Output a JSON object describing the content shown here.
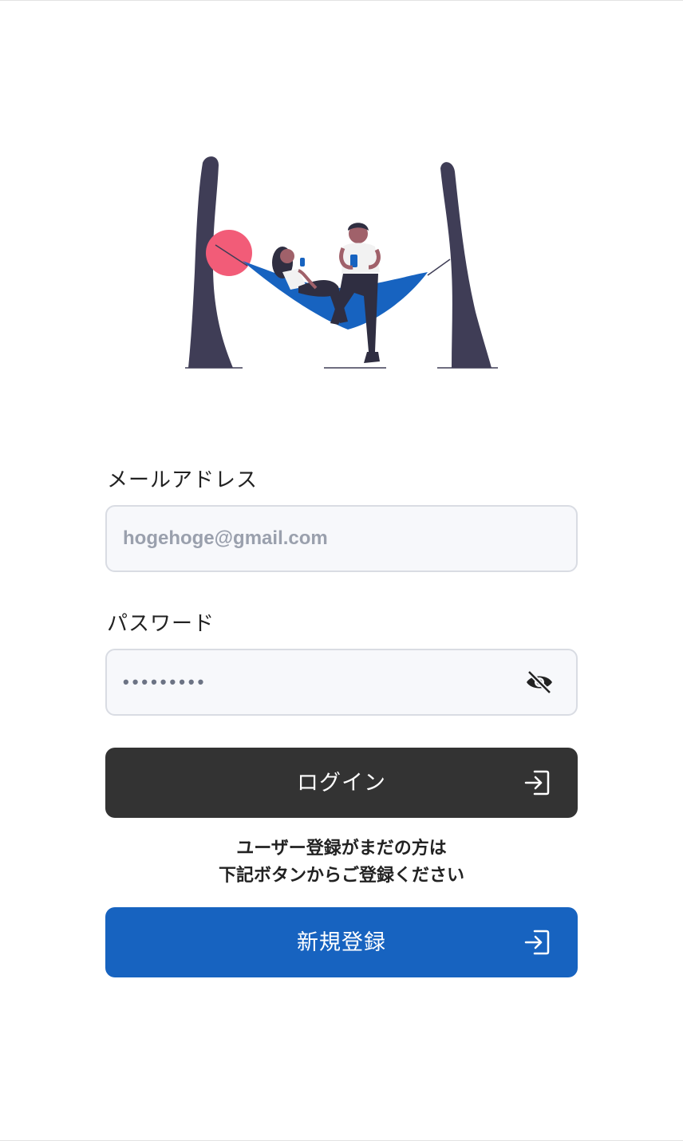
{
  "illustration": {
    "description_icon": "hammock-illustration-icon",
    "colors": {
      "tree": "#3f3d56",
      "hammock": "#1763c0",
      "sun": "#f25c78",
      "skin": "#a0616a",
      "hair": "#2f2e41",
      "shirt": "#f2f2f2"
    }
  },
  "form": {
    "email": {
      "label": "メールアドレス",
      "placeholder": "hogehoge@gmail.com",
      "value": ""
    },
    "password": {
      "label": "パスワード",
      "value": "•••••••••",
      "toggle_icon": "eye-slash-icon"
    },
    "login_button": {
      "label": "ログイン",
      "icon": "login-icon",
      "color": "#333333"
    },
    "notice": {
      "line1": "ユーザー登録がまだの方は",
      "line2": "下記ボタンからご登録ください"
    },
    "register_button": {
      "label": "新規登録",
      "icon": "login-icon",
      "color": "#1763c0"
    }
  }
}
